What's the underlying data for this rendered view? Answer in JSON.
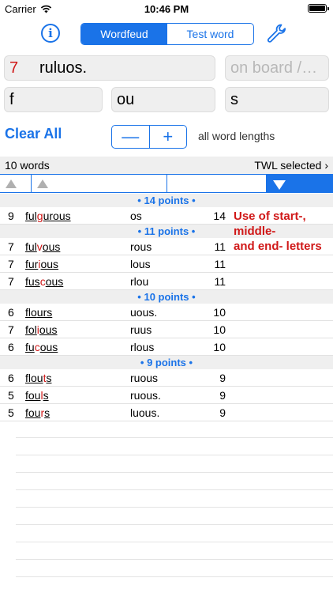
{
  "status": {
    "carrier": "Carrier",
    "time": "10:46 PM"
  },
  "nav": {
    "info_label": "i",
    "tabs": [
      {
        "label": "Wordfeud",
        "active": true
      },
      {
        "label": "Test word",
        "active": false
      }
    ]
  },
  "inputs": {
    "letters_count": "7",
    "letters_value": "ruluos.",
    "board_placeholder": "on board /…",
    "start_value": "f",
    "middle_value": "ou",
    "end_value": "s"
  },
  "controls": {
    "clear_all_label": "Clear All",
    "minus_label": "—",
    "plus_label": "+",
    "lengths_label": "all word lengths"
  },
  "summary": {
    "count": "10 words",
    "dictionary": "TWL selected"
  },
  "groups": [
    {
      "header": "• 14 points •",
      "rows": [
        {
          "len": "9",
          "w1": "ful",
          "w2": "g",
          "w3": "urous",
          "rest": "os",
          "pts": "14"
        }
      ]
    },
    {
      "header": "• 11 points •",
      "rows": [
        {
          "len": "7",
          "w1": "ful",
          "w2": "v",
          "w3": "ous",
          "rest": "rous",
          "pts": "11"
        },
        {
          "len": "7",
          "w1": "fur",
          "w2": "i",
          "w3": "ous",
          "rest": "lous",
          "pts": "11"
        },
        {
          "len": "7",
          "w1": "fus",
          "w2": "c",
          "w3": "ous",
          "rest": "rlou",
          "pts": "11"
        }
      ]
    },
    {
      "header": "• 10 points •",
      "rows": [
        {
          "len": "6",
          "w1": "flo",
          "w2": "",
          "w3": "urs",
          "rest": "uous.",
          "pts": "10"
        },
        {
          "len": "7",
          "w1": "fol",
          "w2": "i",
          "w3": "ous",
          "rest": "ruus",
          "pts": "10"
        },
        {
          "len": "6",
          "w1": "fu",
          "w2": "c",
          "w3": "ous",
          "rest": "rlous",
          "pts": "10"
        }
      ]
    },
    {
      "header": "• 9 points •",
      "rows": [
        {
          "len": "6",
          "w1": "flou",
          "w2": "t",
          "w3": "s",
          "rest": "ruous",
          "pts": "9"
        },
        {
          "len": "5",
          "w1": "fou",
          "w2": "l",
          "w3": "s",
          "rest": "ruous.",
          "pts": "9"
        },
        {
          "len": "5",
          "w1": "fou",
          "w2": "r",
          "w3": "s",
          "rest": "luous.",
          "pts": "9"
        }
      ]
    }
  ],
  "note": {
    "line1": "Use of start-,",
    "line2": "middle-",
    "line3": "and end- letters"
  },
  "colors": {
    "accent": "#1a73e8",
    "highlight": "#d01818",
    "field_bg": "#efefef"
  }
}
